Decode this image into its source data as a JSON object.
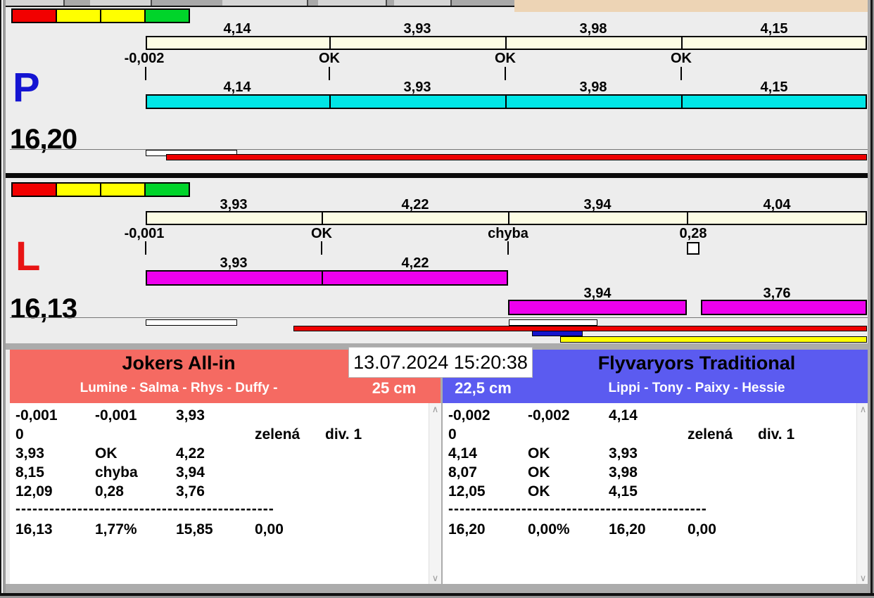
{
  "colors": {
    "background": "#ededed",
    "beige_bar": "#fcfce4",
    "cyan_bar": "#00e6e6",
    "magenta_bar": "#ee00ee",
    "red_bar": "#ee0000",
    "blue_bar": "#1515cc",
    "yellow_bar": "#ffff00",
    "traffic_red": "#f20000",
    "traffic_yellow": "#ffff00",
    "traffic_green": "#00d42a",
    "left_header": "#f56a62",
    "right_header": "#5b5bf0",
    "lane_p_letter": "#1414d2",
    "lane_l_letter": "#e81414",
    "top_right_area": "#edd4b5"
  },
  "clock": "13.07.2024 15:20:38",
  "lane_p": {
    "letter": "P",
    "total": "16,20",
    "upper_values": [
      "4,14",
      "3,93",
      "3,98",
      "4,15"
    ],
    "checks": [
      "-0,002",
      "OK",
      "OK",
      "OK"
    ],
    "lower_values": [
      "4,14",
      "3,93",
      "3,98",
      "4,15"
    ]
  },
  "lane_l": {
    "letter": "L",
    "total": "16,13",
    "upper_values": [
      "3,93",
      "4,22",
      "3,94",
      "4,04"
    ],
    "checks": [
      "-0,001",
      "OK",
      "chyba",
      "0,28"
    ],
    "lower_values_left": [
      "3,93",
      "4,22"
    ],
    "lower_values_right": [
      "3,94",
      "3,76"
    ]
  },
  "left_team": {
    "name": "Jokers All-in",
    "members": "Lumine - Salma - Rhys - Duffy -",
    "distance": "25 cm",
    "rows": [
      {
        "c1": "-0,001",
        "c2": "-0,001",
        "c3": "3,93",
        "c4": "",
        "c5": ""
      },
      {
        "c1": "0",
        "c2": "",
        "c3": "",
        "c4": "zelená",
        "c5": "div. 1"
      },
      {
        "c1": "3,93",
        "c2": "OK",
        "c3": "4,22",
        "c4": "",
        "c5": ""
      },
      {
        "c1": "8,15",
        "c2": "chyba",
        "c3": "3,94",
        "c4": "",
        "c5": ""
      },
      {
        "c1": "12,09",
        "c2": "0,28",
        "c3": "3,76",
        "c4": "",
        "c5": ""
      }
    ],
    "separator": "----------------------------------------------",
    "total_row": {
      "c1": "16,13",
      "c2": "1,77%",
      "c3": "15,85",
      "c4": "0,00"
    }
  },
  "right_team": {
    "name": "Flyvaryors Traditional",
    "members": "Lippi - Tony - Paixy - Hessie",
    "distance": "22,5 cm",
    "rows": [
      {
        "c1": "-0,002",
        "c2": "-0,002",
        "c3": "4,14",
        "c4": "",
        "c5": ""
      },
      {
        "c1": "0",
        "c2": "",
        "c3": "",
        "c4": "zelená",
        "c5": "div. 1"
      },
      {
        "c1": "4,14",
        "c2": "OK",
        "c3": "3,93",
        "c4": "",
        "c5": ""
      },
      {
        "c1": "8,07",
        "c2": "OK",
        "c3": "3,98",
        "c4": "",
        "c5": ""
      },
      {
        "c1": "12,05",
        "c2": "OK",
        "c3": "4,15",
        "c4": "",
        "c5": ""
      }
    ],
    "separator": "----------------------------------------------",
    "total_row": {
      "c1": "16,20",
      "c2": "0,00%",
      "c3": "16,20",
      "c4": "0,00"
    }
  },
  "scrollbar": {
    "up": "∧",
    "down": "∨"
  }
}
